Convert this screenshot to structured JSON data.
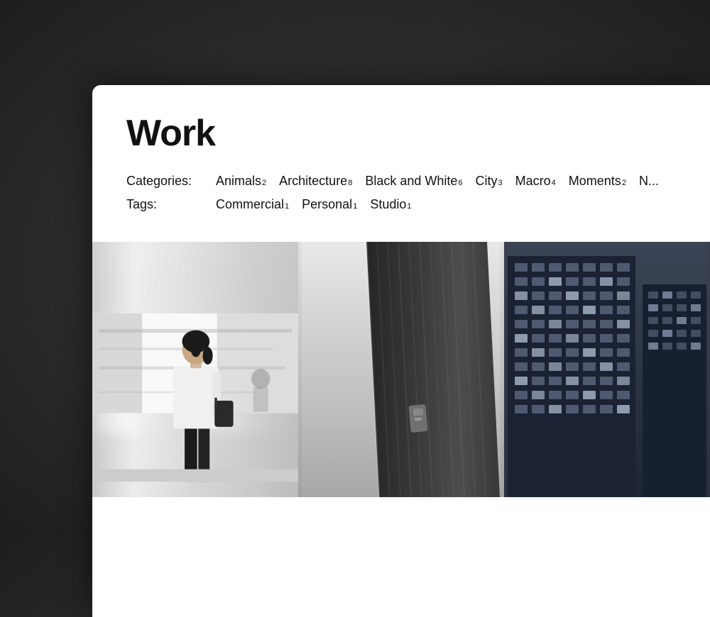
{
  "page": {
    "title": "Work",
    "background_color": "#2a2a2a",
    "card_background": "#ffffff"
  },
  "categories": {
    "label": "Categories:",
    "items": [
      {
        "name": "Animals",
        "count": "2"
      },
      {
        "name": "Architecture",
        "count": "8"
      },
      {
        "name": "Black and White",
        "count": "6"
      },
      {
        "name": "City",
        "count": "3"
      },
      {
        "name": "Macro",
        "count": "4"
      },
      {
        "name": "Moments",
        "count": "2"
      },
      {
        "name": "N...",
        "count": ""
      }
    ]
  },
  "tags": {
    "label": "Tags:",
    "items": [
      {
        "name": "Commercial",
        "count": "1"
      },
      {
        "name": "Personal",
        "count": "1"
      },
      {
        "name": "Studio",
        "count": "1"
      }
    ]
  },
  "gallery": {
    "images": [
      {
        "id": "subway",
        "alt": "Woman waiting for subway train, black and white"
      },
      {
        "id": "architecture",
        "alt": "Close up of dark architectural detail, diagonal lines"
      },
      {
        "id": "city",
        "alt": "City buildings, dark blue tones"
      }
    ]
  }
}
